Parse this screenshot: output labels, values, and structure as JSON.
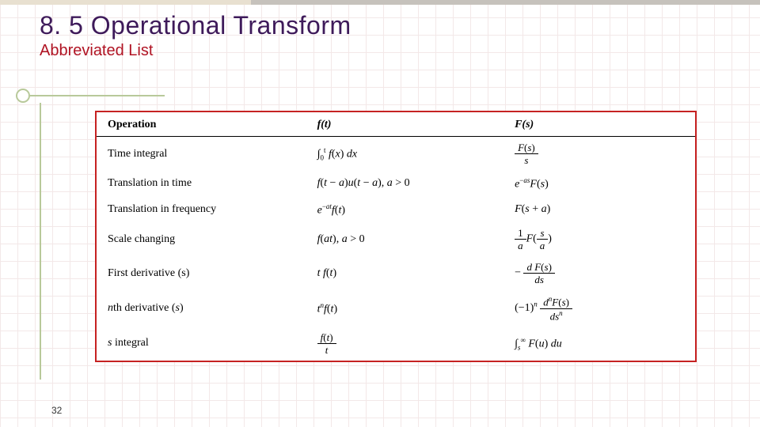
{
  "slide": {
    "title": "8. 5 Operational Transform",
    "subtitle": "Abbreviated List",
    "page_number": "32"
  },
  "table": {
    "headers": {
      "operation": "Operation",
      "ft": "f(t)",
      "Fs": "F(s)"
    },
    "rows": [
      {
        "operation": "Time integral",
        "ft_html": "∫<span class='sub'>0</span><span class='sup'>t</span> <span class='ital'>f</span>(<span class='ital'>x</span>) <span class='ital'>dx</span>",
        "Fs_html": "<span class='frac'><span class='num'><span class='ital'>F</span>(<span class='ital'>s</span>)</span><span class='den'><span class='ital'>s</span></span></span>"
      },
      {
        "operation": "Translation in time",
        "ft_html": "<span class='ital'>f</span>(<span class='ital'>t</span> − <span class='ital'>a</span>)<span class='ital'>u</span>(<span class='ital'>t</span> − <span class='ital'>a</span>), <span class='ital'>a</span> > 0",
        "Fs_html": "<span class='ital'>e</span><span class='sup'>−<span class='ital'>as</span></span><span class='ital'>F</span>(<span class='ital'>s</span>)"
      },
      {
        "operation": "Translation in frequency",
        "ft_html": "<span class='ital'>e</span><span class='sup'>−<span class='ital'>at</span></span><span class='ital'>f</span>(<span class='ital'>t</span>)",
        "Fs_html": "<span class='ital'>F</span>(<span class='ital'>s</span> + <span class='ital'>a</span>)"
      },
      {
        "operation": "Scale changing",
        "ft_html": "<span class='ital'>f</span>(<span class='ital'>at</span>), <span class='ital'>a</span> > 0",
        "Fs_html": "<span class='frac'><span class='num'>1</span><span class='den'><span class='ital'>a</span></span></span><span class='ital'>F</span>(<span class='frac'><span class='num'><span class='ital'>s</span></span><span class='den'><span class='ital'>a</span></span></span>)"
      },
      {
        "operation": "First derivative (s)",
        "ft_html": "<span class='ital'>t f</span>(<span class='ital'>t</span>)",
        "Fs_html": "− <span class='frac'><span class='num'><span class='ital'>d F</span>(<span class='ital'>s</span>)</span><span class='den'><span class='ital'>ds</span></span></span>"
      },
      {
        "operation_html": "<span class='ital'>n</span>th derivative (<span class='ital'>s</span>)",
        "ft_html": "<span class='ital'>t</span><span class='sup'><span class='ital'>n</span></span><span class='ital'>f</span>(<span class='ital'>t</span>)",
        "Fs_html": "(−1)<span class='sup'><span class='ital'>n</span></span> <span class='frac'><span class='num'><span class='ital'>d</span><span class='sup'><span class='ital'>n</span></span><span class='ital'>F</span>(<span class='ital'>s</span>)</span><span class='den'><span class='ital'>ds</span><span class='sup'><span class='ital'>n</span></span></span></span>"
      },
      {
        "operation_html": "<span class='ital'>s</span> integral",
        "ft_html": "<span class='frac'><span class='num'><span class='ital'>f</span>(<span class='ital'>t</span>)</span><span class='den'><span class='ital'>t</span></span></span>",
        "Fs_html": "∫<span class='sub'><span class='ital'>s</span></span><span class='sup'>∞</span> <span class='ital'>F</span>(<span class='ital'>u</span>) <span class='ital'>du</span>"
      }
    ]
  }
}
